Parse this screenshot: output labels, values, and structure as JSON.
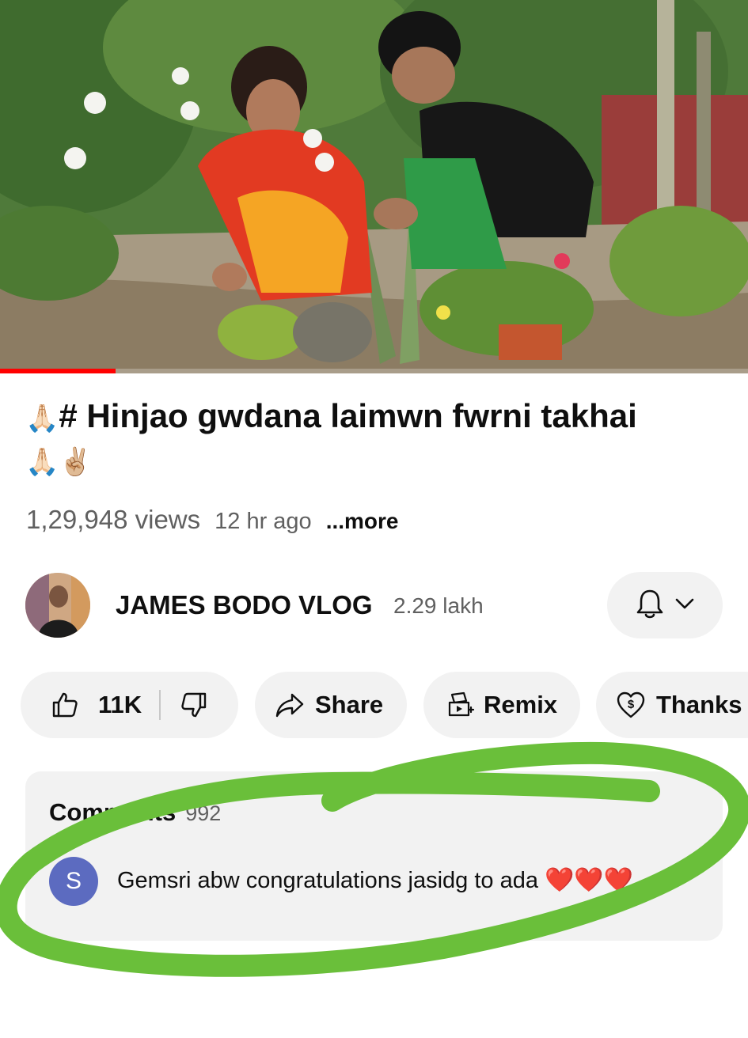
{
  "video": {
    "progress_fraction": 0.155,
    "accent_color": "#ff0000"
  },
  "title": {
    "prefix_emoji": "🙏🏻",
    "text": "# Hinjao gwdana laimwn fwrni takhai",
    "suffix_emoji": "🙏🏻✌🏼"
  },
  "meta": {
    "views": "1,29,948 views",
    "ago": "12 hr ago",
    "more": "...more"
  },
  "channel": {
    "name": "JAMES BODO VLOG",
    "subscribers": "2.29 lakh",
    "bell_icon": "bell-icon",
    "chevron_icon": "chevron-down-icon"
  },
  "actions": {
    "like_count": "11K",
    "share_label": "Share",
    "remix_label": "Remix",
    "thanks_label": "Thanks"
  },
  "comments": {
    "label": "Comments",
    "count": "992",
    "top_comment": {
      "avatar_letter": "S",
      "avatar_color": "#5c6bc0",
      "text": "Gemsri abw congratulations jasidg to ada",
      "hearts": "❤️❤️❤️"
    }
  },
  "annotation": {
    "marker_color": "#6abf3a"
  }
}
